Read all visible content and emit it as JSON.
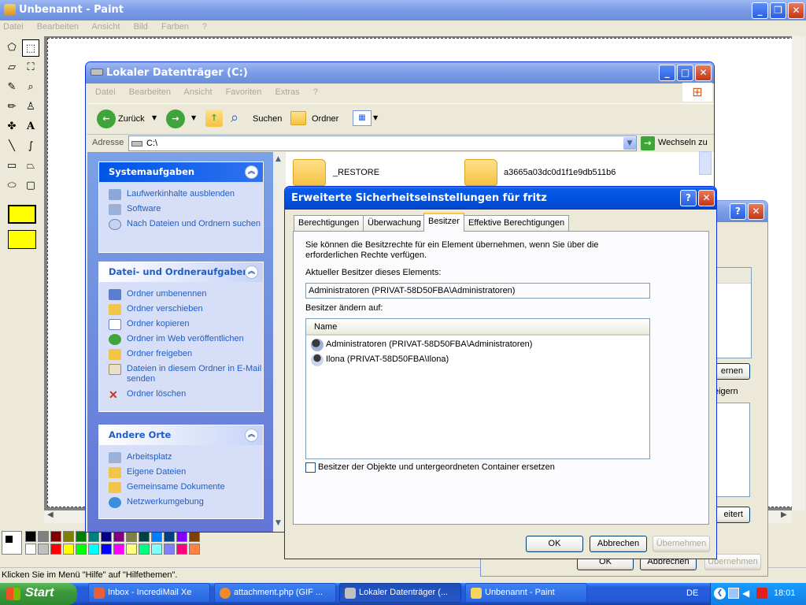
{
  "paint": {
    "title": "Unbenannt - Paint",
    "menu": [
      "Datei",
      "Bearbeiten",
      "Ansicht",
      "Bild",
      "Farben",
      "?"
    ],
    "status": "Klicken Sie im Menü \"Hilfe\" auf \"Hilfethemen\".",
    "palette": [
      "#000000",
      "#808080",
      "#800000",
      "#808000",
      "#008000",
      "#008080",
      "#000080",
      "#800080",
      "#808040",
      "#004040",
      "#0080ff",
      "#004080",
      "#8000ff",
      "#804000",
      "#ffffff",
      "#c0c0c0",
      "#ff0000",
      "#ffff00",
      "#00ff00",
      "#00ffff",
      "#0000ff",
      "#ff00ff",
      "#ffff80",
      "#00ff80",
      "#80ffff",
      "#8080ff",
      "#ff0080",
      "#ff8040"
    ]
  },
  "explorer": {
    "title": "Lokaler Datenträger (C:)",
    "menu": [
      "Datei",
      "Bearbeiten",
      "Ansicht",
      "Favoriten",
      "Extras",
      "?"
    ],
    "toolbar": {
      "back": "Zurück",
      "search": "Suchen",
      "folders": "Ordner"
    },
    "address_label": "Adresse",
    "address_value": "C:\\",
    "go_label": "Wechseln zu",
    "panels": {
      "system": {
        "title": "Systemaufgaben",
        "items": [
          "Laufwerkinhalte ausblenden",
          "Software",
          "Nach Dateien und Ordnern suchen"
        ]
      },
      "file": {
        "title": "Datei- und Ordneraufgaben",
        "items": [
          "Ordner umbenennen",
          "Ordner verschieben",
          "Ordner kopieren",
          "Ordner im Web veröffentlichen",
          "Ordner freigeben",
          "Dateien in diesem Ordner in E-Mail senden",
          "Ordner löschen"
        ]
      },
      "other": {
        "title": "Andere Orte",
        "items": [
          "Arbeitsplatz",
          "Eigene Dateien",
          "Gemeinsame Dokumente",
          "Netzwerkumgebung"
        ]
      }
    },
    "folders": [
      "_RESTORE",
      "a3665a03dc0d1f1e9db511b6"
    ]
  },
  "back_dialog": {
    "partial_labels": [
      "ernen",
      "eigern",
      "eitert"
    ],
    "ok": "OK",
    "cancel": "Abbrechen",
    "apply": "Übernehmen"
  },
  "dialog": {
    "title": "Erweiterte Sicherheitseinstellungen für fritz",
    "tabs": [
      "Berechtigungen",
      "Überwachung",
      "Besitzer",
      "Effektive Berechtigungen"
    ],
    "active_tab": "Besitzer",
    "intro": "Sie können die Besitzrechte für ein Element übernehmen, wenn Sie über die erforderlichen Rechte verfügen.",
    "current_owner_label": "Aktueller Besitzer dieses Elements:",
    "current_owner_value": "Administratoren (PRIVAT-58D50FBA\\Administratoren)",
    "change_owner_label": "Besitzer ändern auf:",
    "list_header": "Name",
    "owners": [
      "Administratoren (PRIVAT-58D50FBA\\Administratoren)",
      "Ilona (PRIVAT-58D50FBA\\Ilona)"
    ],
    "replace_checkbox": "Besitzer der Objekte und untergeordneten Container ersetzen",
    "replace_checked": false,
    "ok": "OK",
    "cancel": "Abbrechen",
    "apply": "Übernehmen"
  },
  "taskbar": {
    "start": "Start",
    "tasks": [
      "Inbox - IncrediMail Xe",
      "attachment.php (GIF ...",
      "Lokaler Datenträger (...",
      "Unbenannt - Paint"
    ],
    "lang": "DE",
    "clock": "18:01"
  }
}
